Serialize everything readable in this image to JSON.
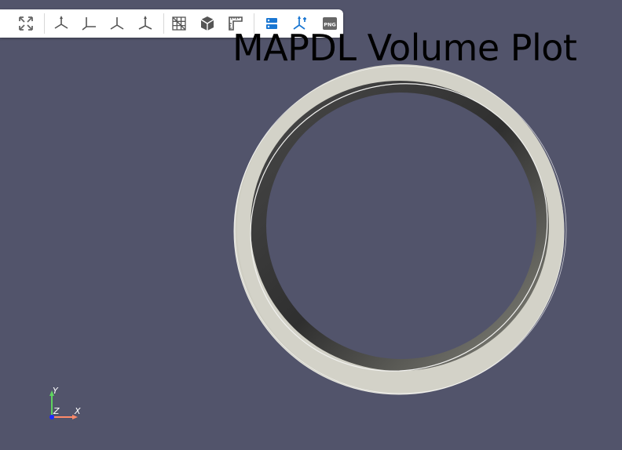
{
  "plot_title": "MAPDL Volume Plot",
  "toolbar": {
    "buttons": [
      {
        "name": "reset-camera",
        "icon": "expand-arrows-icon",
        "tooltip": "Reset Camera"
      },
      {
        "name": "view-isometric",
        "icon": "axes-isometric-icon",
        "tooltip": "Isometric View"
      },
      {
        "name": "view-xy",
        "icon": "axes-xy-icon",
        "tooltip": "XY View"
      },
      {
        "name": "view-yz",
        "icon": "axes-yz-icon",
        "tooltip": "YZ View"
      },
      {
        "name": "view-xz",
        "icon": "axes-xz-icon",
        "tooltip": "XZ View"
      },
      {
        "name": "toggle-mesh",
        "icon": "mesh-grid-icon",
        "tooltip": "Toggle Mesh"
      },
      {
        "name": "toggle-parallel",
        "icon": "cube-icon",
        "tooltip": "Parallel Projection"
      },
      {
        "name": "measure",
        "icon": "ruler-icon",
        "tooltip": "Measure"
      },
      {
        "name": "tree-menu",
        "icon": "layers-icon",
        "tooltip": "Tree Menu"
      },
      {
        "name": "explode",
        "icon": "explode-axes-icon",
        "tooltip": "Explode"
      },
      {
        "name": "screenshot",
        "icon": "png-icon",
        "tooltip": "Screenshot",
        "label": "PNG"
      }
    ]
  },
  "orientation_axes": {
    "y_label": "Y",
    "z_label": "Z",
    "x_label": "X",
    "y_color": "#5fd35f",
    "x_color": "#ff8a6a",
    "z_color": "#1a2bff"
  },
  "colors": {
    "background": "#52546b",
    "ring_light": "#d0cfc4",
    "ring_dark": "#3c3c3c",
    "accent_blue": "#1976d2"
  }
}
